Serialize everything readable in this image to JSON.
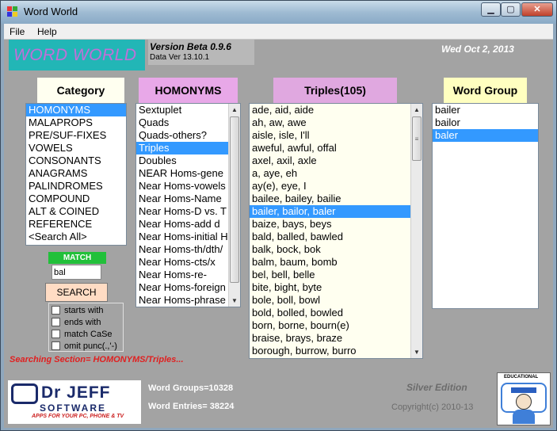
{
  "window": {
    "title": "Word World",
    "buttons": {
      "minimize": "▁",
      "maximize": "▢",
      "close": "✕"
    }
  },
  "menu": [
    "File",
    "Help"
  ],
  "header": {
    "logo": "WORD WORLD",
    "version": "Version Beta 0.9.6",
    "data_version": "Data Ver 13.10.1",
    "date": "Wed  Oct 2, 2013"
  },
  "category": {
    "title": "Category",
    "items": [
      "HOMONYMS",
      "MALAPROPS",
      "PRE/SUF-FIXES",
      "VOWELS",
      "CONSONANTS",
      "ANAGRAMS",
      "PALINDROMES",
      "COMPOUND",
      "ALT & COINED",
      "REFERENCE",
      "<Search All>"
    ],
    "selected": 0
  },
  "subcategory": {
    "title": "HOMONYMS",
    "items": [
      "Sextuplet",
      "Quads",
      "Quads-others?",
      "Triples",
      "Doubles",
      "NEAR Homs-gene",
      "Near Homs-vowels",
      "Near Homs-Name",
      "Near Homs-D vs. T",
      "Near Homs-add d",
      "Near Homs-initial H",
      "Near Homs-th/dth/",
      "Near Homs-cts/x",
      "Near Homs-re-",
      "Near Homs-foreign",
      "Near Homs-phrase"
    ],
    "selected": 3
  },
  "triples": {
    "title": "Triples(105)",
    "items": [
      "ade, aid, aide",
      "ah, aw, awe",
      "aisle, isle, I'll",
      "aweful, awful, offal",
      "axel, axil, axle",
      "a, aye, eh",
      "ay(e), eye, I",
      "bailee, bailey, bailie",
      "bailer, bailor, baler",
      "baize, bays, beys",
      "bald, balled, bawled",
      "balk, bock, bok",
      "balm, baum, bomb",
      "bel, bell, belle",
      "bite, bight, byte",
      "bole, boll, bowl",
      "bold, bolled, bowled",
      "born, borne, bourn(e)",
      "braise, brays, braze",
      "borough, burrow, burro"
    ],
    "selected": 8
  },
  "word_group": {
    "title": "Word Group",
    "items": [
      "bailer",
      "bailor",
      "baler"
    ],
    "selected": 2
  },
  "search": {
    "match_label": "MATCH",
    "value": "bal",
    "button": "SEARCH",
    "options": [
      "starts with",
      "ends with",
      "match CaSe",
      "omit punc(.,'-)"
    ]
  },
  "status": "Searching Section= HOMONYMS/Triples...",
  "footer": {
    "brand_name": "Dr JEFF",
    "brand_sub": "SOFTWARE",
    "brand_tag": "APPS FOR YOUR PC, PHONE & TV",
    "word_groups": "Word Groups=10328",
    "word_entries": "Word Entries= 38224",
    "edition": "Silver Edition",
    "copyright": "Copyright(c) 2010-13",
    "edu_label": "EDUCATIONAL"
  },
  "colors": {
    "selection": "#3399ff",
    "category_header": "#fffff0",
    "homonyms_header": "#e8a8e8",
    "triples_header": "#e0a8e0",
    "triples_list": "#fffff0",
    "wordgroup_header": "#ffffc0",
    "logo_bg": "#22b6b6",
    "status": "#e02020"
  }
}
